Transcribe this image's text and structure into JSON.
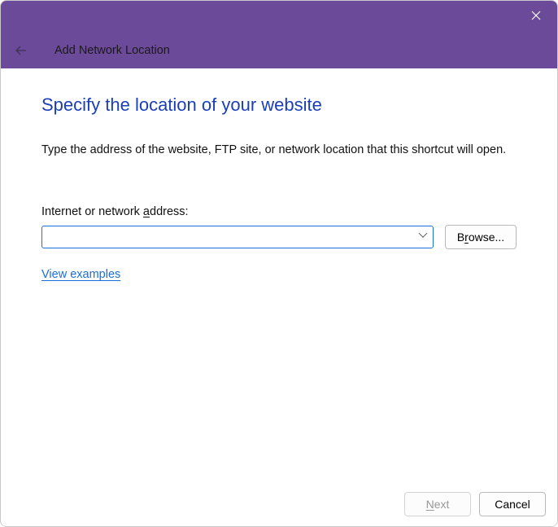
{
  "header": {
    "wizard_title": "Add Network Location"
  },
  "content": {
    "heading": "Specify the location of your website",
    "instruction": "Type the address of the website, FTP site, or network location that this shortcut will open.",
    "field_label_pre": "Internet or network ",
    "field_label_accel": "a",
    "field_label_post": "ddress:",
    "address_value": "",
    "browse_pre": "B",
    "browse_accel": "r",
    "browse_post": "owse...",
    "examples_link": "View examples"
  },
  "footer": {
    "next_accel": "N",
    "next_post": "ext",
    "cancel": "Cancel"
  }
}
